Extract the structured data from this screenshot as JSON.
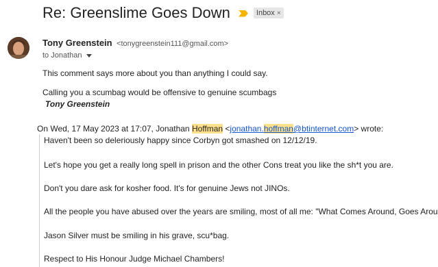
{
  "email": {
    "subject": "Re: Greenslime Goes Down",
    "label": "Inbox",
    "label_close": "×",
    "sender_name": "Tony Greenstein",
    "sender_email": "<tonygreenstein111@gmail.com>",
    "to_line": "to Jonathan",
    "body": [
      "This comment says more about you than anything I could say.",
      "Calling you a scumbag would be offensive to genuine scumbags"
    ],
    "signature": "Tony Greenstein"
  },
  "quote": {
    "header_prefix": "On Wed, 17 May 2023 at 17:07, Jonathan ",
    "header_highlight1": "Hoffman",
    "header_mid": " <",
    "link_part1": "jonathan.",
    "link_highlight": "hoffman",
    "link_part2": "@btinternet.com",
    "header_suffix": "> wrote:",
    "lines": [
      "Haven't been so deleriously happy since Corbyn got smashed on 12/12/19.",
      "Let's hope you get a really long spell in prison and the other Cons treat you like the sh*t you are.",
      "Don't you dare ask for kosher food. It's for genuine Jews not JINOs.",
      "All the people you have abused over the years are smiling, most of all me: \"What Comes Around, Goes Around\"",
      "Jason Silver must be smiling in his grave, scu*bag.",
      "Respect to His Honour Judge Michael Chambers!"
    ]
  }
}
